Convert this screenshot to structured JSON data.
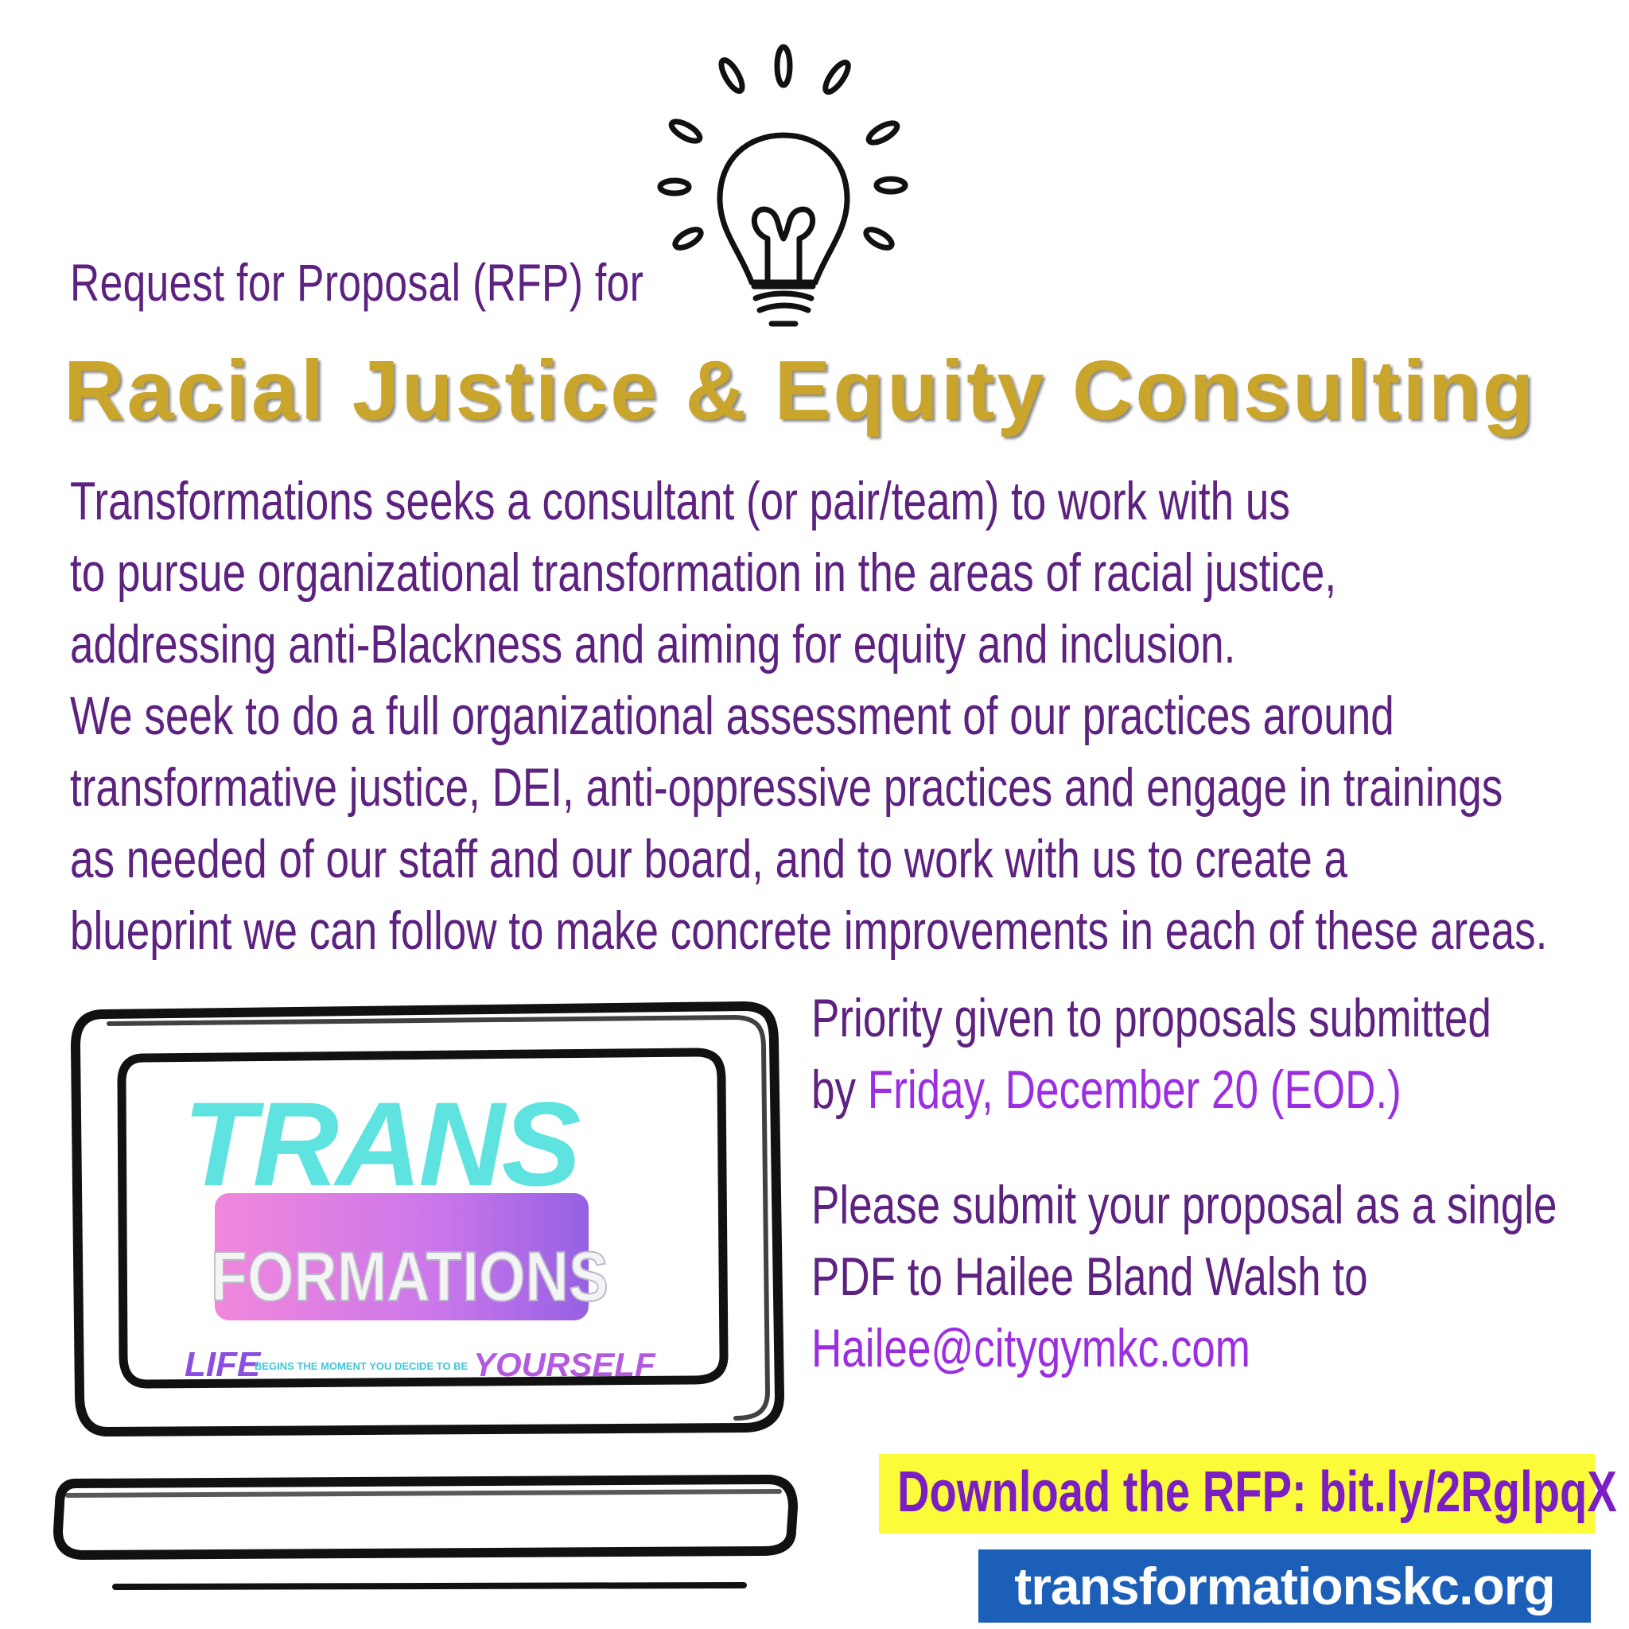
{
  "kicker": "Request for Proposal (RFP) for",
  "headline": "Racial Justice & Equity Consulting",
  "body_lines": [
    "Transformations seeks a consultant (or pair/team) to work with us",
    "to pursue organizational transformation in the areas of racial justice,",
    "addressing anti-Blackness and aiming for equity and inclusion.",
    "We seek to do a full organizational assessment of our practices around",
    "transformative justice, DEI, anti-oppressive practices and engage in trainings",
    "as needed of our staff and our board, and to work with us to create a",
    "blueprint we can follow to make concrete improvements in each of these areas."
  ],
  "priority": {
    "line1": "Priority given to proposals submitted",
    "by": "by ",
    "deadline": "Friday, December 20 (EOD.)"
  },
  "submit": {
    "line1": "Please submit your proposal as a single",
    "line2": "PDF to Hailee Bland Walsh to",
    "email": "Hailee@citygymkc.com"
  },
  "download": "Download the RFP: bit.ly/2RglpqX",
  "website": "transformationskc.org",
  "logo": {
    "trans": "TRANS",
    "formations": "FORMATIONS",
    "tagline_life": "LIFE",
    "tagline_mid": "BEGINS THE MOMENT YOU DECIDE TO BE",
    "tagline_end": "YOURSELF"
  },
  "colors": {
    "purple_text": "#5d2180",
    "highlight_purple": "#9b2ee0",
    "gold": "#c9a52c",
    "yellow_box": "#fcfb3a",
    "blue_box": "#1b5fb8",
    "logo_cyan": "#5ee3e0",
    "logo_pink": "#f07ad8",
    "logo_violet": "#8a4fe0"
  },
  "icons": [
    "lightbulb-icon",
    "laptop-icon"
  ]
}
